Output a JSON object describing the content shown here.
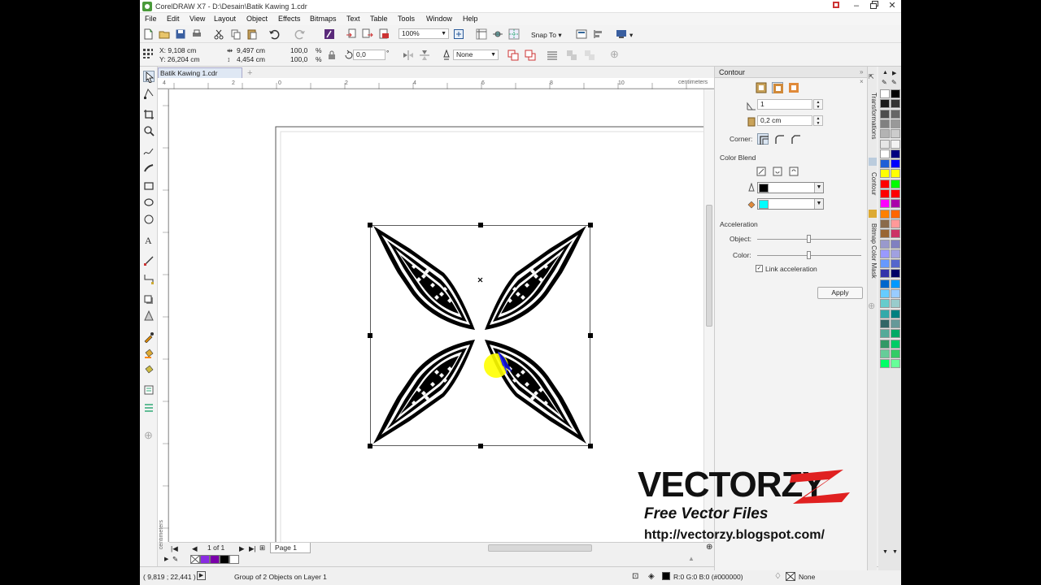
{
  "window": {
    "title": "CorelDRAW X7 - D:\\Desain\\Batik Kawing 1.cdr",
    "controls": [
      "restore",
      "minimize",
      "maximize",
      "close"
    ]
  },
  "menu": [
    "File",
    "Edit",
    "View",
    "Layout",
    "Object",
    "Effects",
    "Bitmaps",
    "Text",
    "Table",
    "Tools",
    "Window",
    "Help"
  ],
  "toolbar": {
    "zoom_value": "100%",
    "snap_label": "Snap To"
  },
  "property_bar": {
    "x": "X: 9,108 cm",
    "y": "Y: 26,204 cm",
    "width": "9,497 cm",
    "height": "4,454 cm",
    "scale_x": "100,0",
    "scale_y": "100,0",
    "percent": "%",
    "rotation": "0,0",
    "degree": "°",
    "outline_width": "None"
  },
  "document": {
    "tab_label": "Batik Kawing 1.cdr",
    "ruler_units": "centimeters",
    "page_of": "1 of 1",
    "page_tab": "Page 1"
  },
  "contour_docker": {
    "title": "Contour",
    "steps_value": "1",
    "offset_value": "0,2 cm",
    "corner_label": "Corner:",
    "color_blend_label": "Color Blend",
    "outline_color": "#000000",
    "fill_color": "#00ffff",
    "acceleration_label": "Acceleration",
    "object_label": "Object:",
    "color_label": "Color:",
    "object_accel": 0.5,
    "color_accel": 0.5,
    "link_acceleration_label": "Link acceleration",
    "link_acceleration_checked": true,
    "apply_label": "Apply"
  },
  "side_tabs": [
    "Transformations",
    "Contour",
    "Bitmap Color Mask"
  ],
  "palette_colors": [
    "#ffffff",
    "#000000",
    "#1a1a1a",
    "#333333",
    "#4d4d4d",
    "#666666",
    "#808080",
    "#999999",
    "#b3b3b3",
    "#cccccc",
    "#e6e6e6",
    "#f2f2f2",
    "#ffffff",
    "#000080",
    "#1f5fd6",
    "#0000ff",
    "#ffff00",
    "#ffff00",
    "#ff0000",
    "#00ff00",
    "#ff0000",
    "#ff0000",
    "#ff00ff",
    "#aa00aa",
    "#ff8000",
    "#ff6600",
    "#8a6a4a",
    "#ff9999",
    "#996633",
    "#cc3366",
    "#9999cc",
    "#8080c0",
    "#9999ff",
    "#a0a0e0",
    "#6699ff",
    "#5566cc",
    "#3333aa",
    "#000066",
    "#0066cc",
    "#0099ff",
    "#66ccff",
    "#99ccff",
    "#66cccc",
    "#99cccc",
    "#33aaaa",
    "#008080",
    "#336666",
    "#669999",
    "#55aa99",
    "#00aa66",
    "#339966",
    "#00cc66",
    "#66cc99",
    "#33cc66",
    "#00ff66",
    "#66ff99"
  ],
  "document_palette": [
    "#ffffff",
    "#8a2be2",
    "#7a00aa",
    "#000000",
    "#ffffff"
  ],
  "status": {
    "coords": "( 9,819 ; 22,441 )",
    "message": "Group of 2 Objects on Layer 1",
    "fill_info": "R:0 G:0 B:0 (#000000)",
    "outline_info": "None"
  },
  "watermark": {
    "title": "VECTORZY",
    "subtitle": "Free Vector Files",
    "url": "http://vectorzy.blogspot.com/"
  }
}
